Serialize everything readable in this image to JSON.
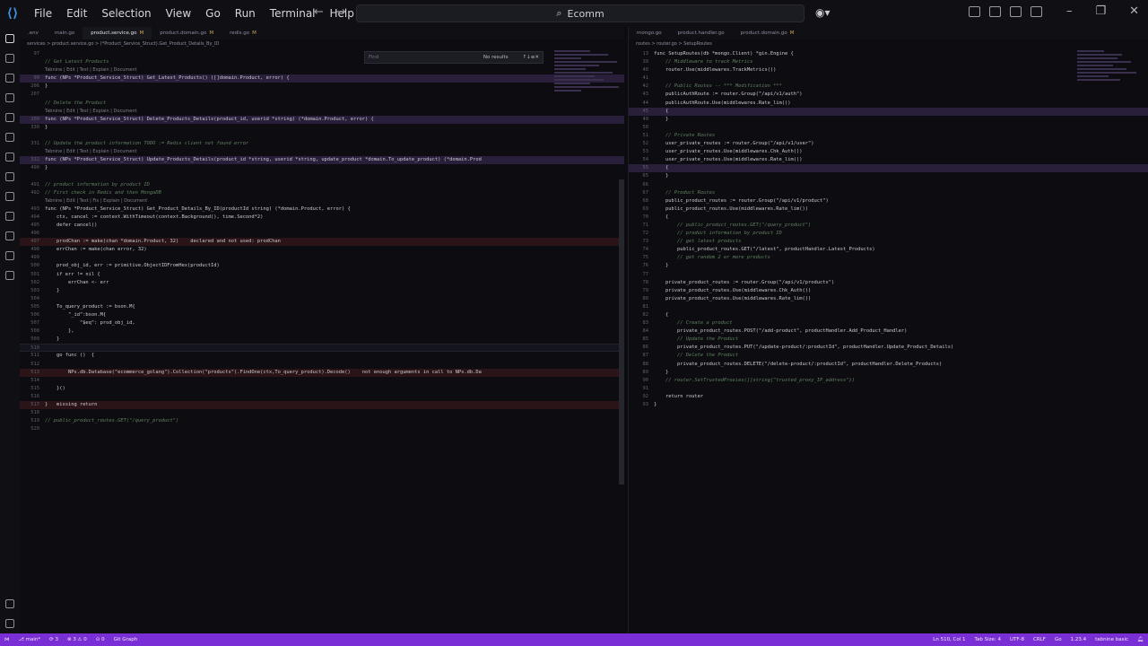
{
  "window": {
    "search_text": "Ecomm",
    "menu": [
      "File",
      "Edit",
      "Selection",
      "View",
      "Go",
      "Run",
      "Terminal",
      "Help"
    ]
  },
  "left": {
    "tabs": [
      {
        "label": ".env",
        "active": false,
        "modified": ""
      },
      {
        "label": "main.go",
        "active": false,
        "modified": ""
      },
      {
        "label": "product.service.go",
        "active": true,
        "modified": "M"
      },
      {
        "label": "product.domain.go",
        "active": false,
        "modified": "M"
      },
      {
        "label": "redis.go",
        "active": false,
        "modified": "M"
      }
    ],
    "breadcrumb": "services > product.service.go > (*Product_Service_Struct).Get_Product_Details_By_ID",
    "find": {
      "placeholder": "Find",
      "result": "No results"
    },
    "lines": [
      {
        "n": "97",
        "t": "",
        "k": ""
      },
      {
        "n": "",
        "t": "// Get Latest Products",
        "k": "cmt"
      },
      {
        "n": "",
        "t": "Tabnine | Edit | Test | Explain | Document",
        "k": "meta"
      },
      {
        "n": "99",
        "t": "func (NPs *Product_Service_Struct) Get_Latest_Products() ([]domain.Product, error) {",
        "k": "hl"
      },
      {
        "n": "206",
        "t": "}",
        "k": ""
      },
      {
        "n": "207",
        "t": "",
        "k": ""
      },
      {
        "n": "",
        "t": "// Delete the Product",
        "k": "cmt"
      },
      {
        "n": "",
        "t": "Tabnine | Edit | Test | Explain | Document",
        "k": "meta"
      },
      {
        "n": "209",
        "t": "func (NPs *Product_Service_Struct) Delete_Products_Details(product_id, userid *string) (*domain.Product, error) {",
        "k": "hl"
      },
      {
        "n": "330",
        "t": "}",
        "k": ""
      },
      {
        "n": "",
        "t": "",
        "k": ""
      },
      {
        "n": "331",
        "t": "// Update the product information TODO := Redis client not found error",
        "k": "cmt"
      },
      {
        "n": "",
        "t": "Tabnine | Edit | Test | Explain | Document",
        "k": "meta"
      },
      {
        "n": "332",
        "t": "func (NPs *Product_Service_Struct) Update_Products_Details(product_id *string, userid *string, update_product *domain.To_update_product) (*domain.Prod",
        "k": "hl"
      },
      {
        "n": "490",
        "t": "}",
        "k": ""
      },
      {
        "n": "",
        "t": "",
        "k": ""
      },
      {
        "n": "491",
        "t": "// product information by product ID",
        "k": "cmt"
      },
      {
        "n": "492",
        "t": "// First check in Redis and then MongoDB",
        "k": "cmt"
      },
      {
        "n": "",
        "t": "Tabnine | Edit | Test | Fix | Explain | Document",
        "k": "meta"
      },
      {
        "n": "493",
        "t": "func (NPs *Product_Service_Struct) Get_Product_Details_By_ID(productId string) (*domain.Product, error) {",
        "k": ""
      },
      {
        "n": "494",
        "t": "    ctx, cancel := context.WithTimeout(context.Background(), time.Second*2)",
        "k": ""
      },
      {
        "n": "495",
        "t": "    defer cancel()",
        "k": ""
      },
      {
        "n": "496",
        "t": "",
        "k": ""
      },
      {
        "n": "497",
        "t": "    prodChan := make(chan *domain.Product, 32)    declared and not used: prodChan",
        "k": "err"
      },
      {
        "n": "498",
        "t": "    errChan := make(chan error, 32)",
        "k": ""
      },
      {
        "n": "499",
        "t": "",
        "k": ""
      },
      {
        "n": "500",
        "t": "    prod_obj_id, err := primitive.ObjectIDFromHex(productId)",
        "k": ""
      },
      {
        "n": "501",
        "t": "    if err != nil {",
        "k": ""
      },
      {
        "n": "502",
        "t": "        errChan <- err",
        "k": ""
      },
      {
        "n": "503",
        "t": "    }",
        "k": ""
      },
      {
        "n": "504",
        "t": "",
        "k": ""
      },
      {
        "n": "505",
        "t": "    To_query_product := bson.M{",
        "k": ""
      },
      {
        "n": "506",
        "t": "        \"_id\":bson.M{",
        "k": ""
      },
      {
        "n": "507",
        "t": "            \"$eq\": prod_obj_id,",
        "k": ""
      },
      {
        "n": "508",
        "t": "        },",
        "k": ""
      },
      {
        "n": "509",
        "t": "    }",
        "k": ""
      },
      {
        "n": "510",
        "t": "",
        "k": "cur"
      },
      {
        "n": "511",
        "t": "    go func ()  {",
        "k": ""
      },
      {
        "n": "512",
        "t": "",
        "k": ""
      },
      {
        "n": "513",
        "t": "        NPs.db.Database(\"ecommerce_golang\").Collection(\"products\").FindOne(ctx,To_query_product).Decode()    not enough arguments in call to NPs.db.Da",
        "k": "err"
      },
      {
        "n": "514",
        "t": "",
        "k": ""
      },
      {
        "n": "515",
        "t": "    }()",
        "k": ""
      },
      {
        "n": "516",
        "t": "",
        "k": ""
      },
      {
        "n": "517",
        "t": "}   missing return",
        "k": "err"
      },
      {
        "n": "518",
        "t": "",
        "k": ""
      },
      {
        "n": "519",
        "t": "// public_product_routes.GET(\"/query_product\")",
        "k": "cmt"
      },
      {
        "n": "520",
        "t": "",
        "k": ""
      }
    ]
  },
  "right": {
    "tabs": [
      {
        "label": "mongo.go",
        "active": false,
        "modified": ""
      },
      {
        "label": "product.handler.go",
        "active": false,
        "modified": ""
      },
      {
        "label": "product.domain.go",
        "active": false,
        "modified": "M"
      }
    ],
    "breadcrumb": "routes > router.go > SetupRoutes",
    "lines": [
      {
        "n": "13",
        "t": "func SetupRoutes(db *mongo.Client) *gin.Engine {",
        "k": ""
      },
      {
        "n": "39",
        "t": "    // Middleware to track Metrics",
        "k": "cmt"
      },
      {
        "n": "40",
        "t": "    router.Use(middlewares.TrackMetrics())",
        "k": ""
      },
      {
        "n": "41",
        "t": "",
        "k": ""
      },
      {
        "n": "42",
        "t": "    // Public Routes -- *** Modification ***",
        "k": "cmt"
      },
      {
        "n": "43",
        "t": "    publicAuthRoute := router.Group(\"/api/v1/auth\")",
        "k": ""
      },
      {
        "n": "44",
        "t": "    publicAuthRoute.Use(middlewares.Rate_lim())",
        "k": ""
      },
      {
        "n": "45",
        "t": "    {",
        "k": "hl"
      },
      {
        "n": "49",
        "t": "    }",
        "k": ""
      },
      {
        "n": "50",
        "t": "",
        "k": ""
      },
      {
        "n": "51",
        "t": "    // Private Routes",
        "k": "cmt"
      },
      {
        "n": "52",
        "t": "    user_private_routes := router.Group(\"/api/v1/user\")",
        "k": ""
      },
      {
        "n": "53",
        "t": "    user_private_routes.Use(middlewares.Chk_Auth())",
        "k": ""
      },
      {
        "n": "54",
        "t": "    user_private_routes.Use(middlewares.Rate_lim())",
        "k": ""
      },
      {
        "n": "55",
        "t": "    {",
        "k": "hl"
      },
      {
        "n": "65",
        "t": "    }",
        "k": ""
      },
      {
        "n": "66",
        "t": "",
        "k": ""
      },
      {
        "n": "67",
        "t": "    // Product Routes",
        "k": "cmt"
      },
      {
        "n": "68",
        "t": "    public_product_routes := router.Group(\"/api/v1/product\")",
        "k": ""
      },
      {
        "n": "69",
        "t": "    public_product_routes.Use(middlewares.Rate_lim())",
        "k": ""
      },
      {
        "n": "70",
        "t": "    {",
        "k": ""
      },
      {
        "n": "71",
        "t": "        // public_product_routes.GET(\"/query_product\")",
        "k": "cmt"
      },
      {
        "n": "72",
        "t": "        // product information by product ID",
        "k": "cmt"
      },
      {
        "n": "73",
        "t": "        // get latest products",
        "k": "cmt"
      },
      {
        "n": "74",
        "t": "        public_product_routes.GET(\"/latest\", productHandler.Latest_Products)",
        "k": ""
      },
      {
        "n": "75",
        "t": "        // get random 2 or more products",
        "k": "cmt"
      },
      {
        "n": "76",
        "t": "    }",
        "k": ""
      },
      {
        "n": "77",
        "t": "",
        "k": ""
      },
      {
        "n": "78",
        "t": "    private_product_routes := router.Group(\"/api/v1/products\")",
        "k": ""
      },
      {
        "n": "79",
        "t": "    private_product_routes.Use(middlewares.Chk_Auth())",
        "k": ""
      },
      {
        "n": "80",
        "t": "    private_product_routes.Use(middlewares.Rate_lim())",
        "k": ""
      },
      {
        "n": "81",
        "t": "",
        "k": ""
      },
      {
        "n": "82",
        "t": "    {",
        "k": ""
      },
      {
        "n": "83",
        "t": "        // Create a product",
        "k": "cmt"
      },
      {
        "n": "84",
        "t": "        private_product_routes.POST(\"/add-product\", productHandler.Add_Product_Handler)",
        "k": ""
      },
      {
        "n": "85",
        "t": "        // Update the Product",
        "k": "cmt"
      },
      {
        "n": "86",
        "t": "        private_product_routes.PUT(\"/update-product/:productId\", productHandler.Update_Product_Details)",
        "k": ""
      },
      {
        "n": "87",
        "t": "        // Delete the Product",
        "k": "cmt"
      },
      {
        "n": "88",
        "t": "        private_product_routes.DELETE(\"/delete-product/:productId\", productHandler.Delete_Products)",
        "k": ""
      },
      {
        "n": "89",
        "t": "    }",
        "k": ""
      },
      {
        "n": "90",
        "t": "    // router.SetTrustedProxies([]string{\"trusted_proxy_IP_address\"})",
        "k": "cmt"
      },
      {
        "n": "91",
        "t": "",
        "k": ""
      },
      {
        "n": "92",
        "t": "    return router",
        "k": ""
      },
      {
        "n": "93",
        "t": "}",
        "k": ""
      }
    ]
  },
  "status": {
    "branch": "main*",
    "sync": "3",
    "errors": "3",
    "warnings": "0",
    "ports": "0",
    "git_graph": "Git Graph",
    "position": "Ln 510, Col 1",
    "tab_size": "Tab Size: 4",
    "encoding": "UTF-8",
    "eol": "CRLF",
    "language": "Go",
    "go_version": "1.23.4",
    "tabnine": "tabnine basic"
  },
  "colors": {
    "accent": "#7a2fd6",
    "line_highlight": "#2a1f3a",
    "error": "#c4626a"
  }
}
